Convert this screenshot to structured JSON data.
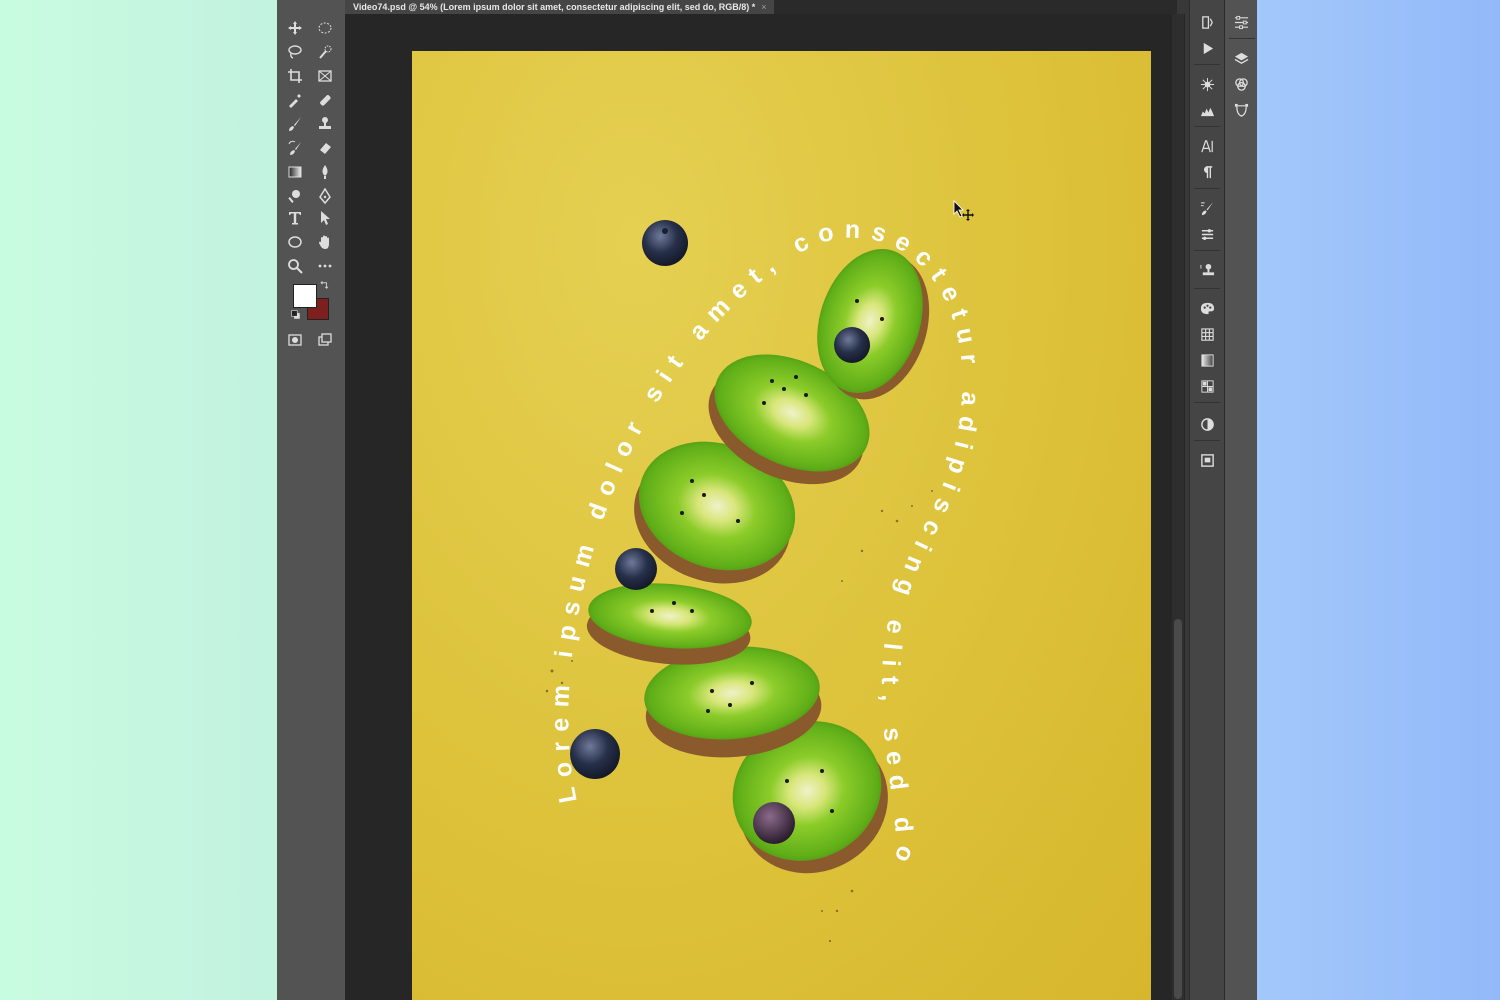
{
  "document_tab": {
    "title": "Video74.psd @ 54% (Lorem ipsum dolor sit amet, consectetur adipiscing elit, sed do, RGB/8) *",
    "close_symbol": "×"
  },
  "canvas_text": {
    "path_text": "Lorem ipsum dolor sit amet, consectetur adipiscing elit, sed do"
  },
  "colors": {
    "foreground": "#ffffff",
    "background": "#7d1f1c",
    "artboard": "#ddc23a"
  },
  "toolbar": {
    "tools": [
      "move-tool",
      "elliptical-marquee-tool",
      "lasso-tool",
      "quick-selection-tool",
      "crop-tool",
      "frame-tool",
      "eyedropper-tool",
      "spot-healing-tool",
      "brush-tool",
      "clone-stamp-tool",
      "history-brush-tool",
      "eraser-tool",
      "gradient-tool",
      "blur-tool",
      "dodge-tool",
      "pen-tool",
      "type-tool",
      "path-selection-tool",
      "ellipse-tool",
      "hand-tool",
      "zoom-tool",
      "more-tools"
    ]
  },
  "panels": {
    "strip1": [
      "history-panel",
      "actions-panel",
      "adjust-panel",
      "histogram-panel",
      "character-panel",
      "paragraph-panel",
      "brush-settings-panel",
      "brushes-panel",
      "clone-source-panel",
      "color-panel",
      "swatches-panel",
      "gradients-panel",
      "patterns-panel",
      "styles-panel",
      "libraries-panel"
    ],
    "strip2": [
      "properties-panel",
      "layers-panel",
      "channels-panel",
      "paths-panel"
    ]
  }
}
